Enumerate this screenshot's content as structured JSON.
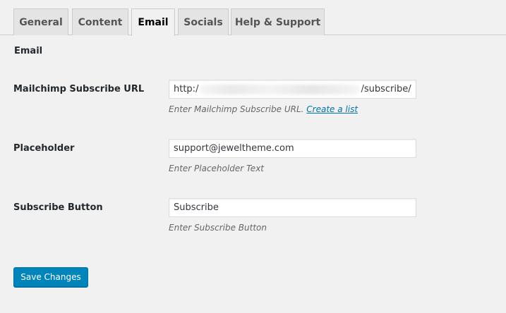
{
  "tabs": [
    {
      "label": "General",
      "active": false
    },
    {
      "label": "Content",
      "active": false
    },
    {
      "label": "Email",
      "active": true
    },
    {
      "label": "Socials",
      "active": false
    },
    {
      "label": "Help & Support",
      "active": false
    }
  ],
  "section": {
    "title": "Email"
  },
  "fields": {
    "mailchimp_url": {
      "label": "Mailchimp Subscribe URL",
      "value_prefix": "http:/",
      "value_suffix": "/subscribe/",
      "description": "Enter Mailchimp Subscribe URL.",
      "link_text": "Create a list"
    },
    "placeholder": {
      "label": "Placeholder",
      "value": "support@jeweltheme.com",
      "description": "Enter Placeholder Text"
    },
    "subscribe_button": {
      "label": "Subscribe Button",
      "value": "Subscribe",
      "description": "Enter Subscribe Button"
    }
  },
  "save_button": {
    "label": "Save Changes"
  },
  "colors": {
    "background": "#f1f1f1",
    "primary_button": "#0085ba",
    "link": "#0073aa",
    "tab_inactive": "#e4e4e4"
  }
}
